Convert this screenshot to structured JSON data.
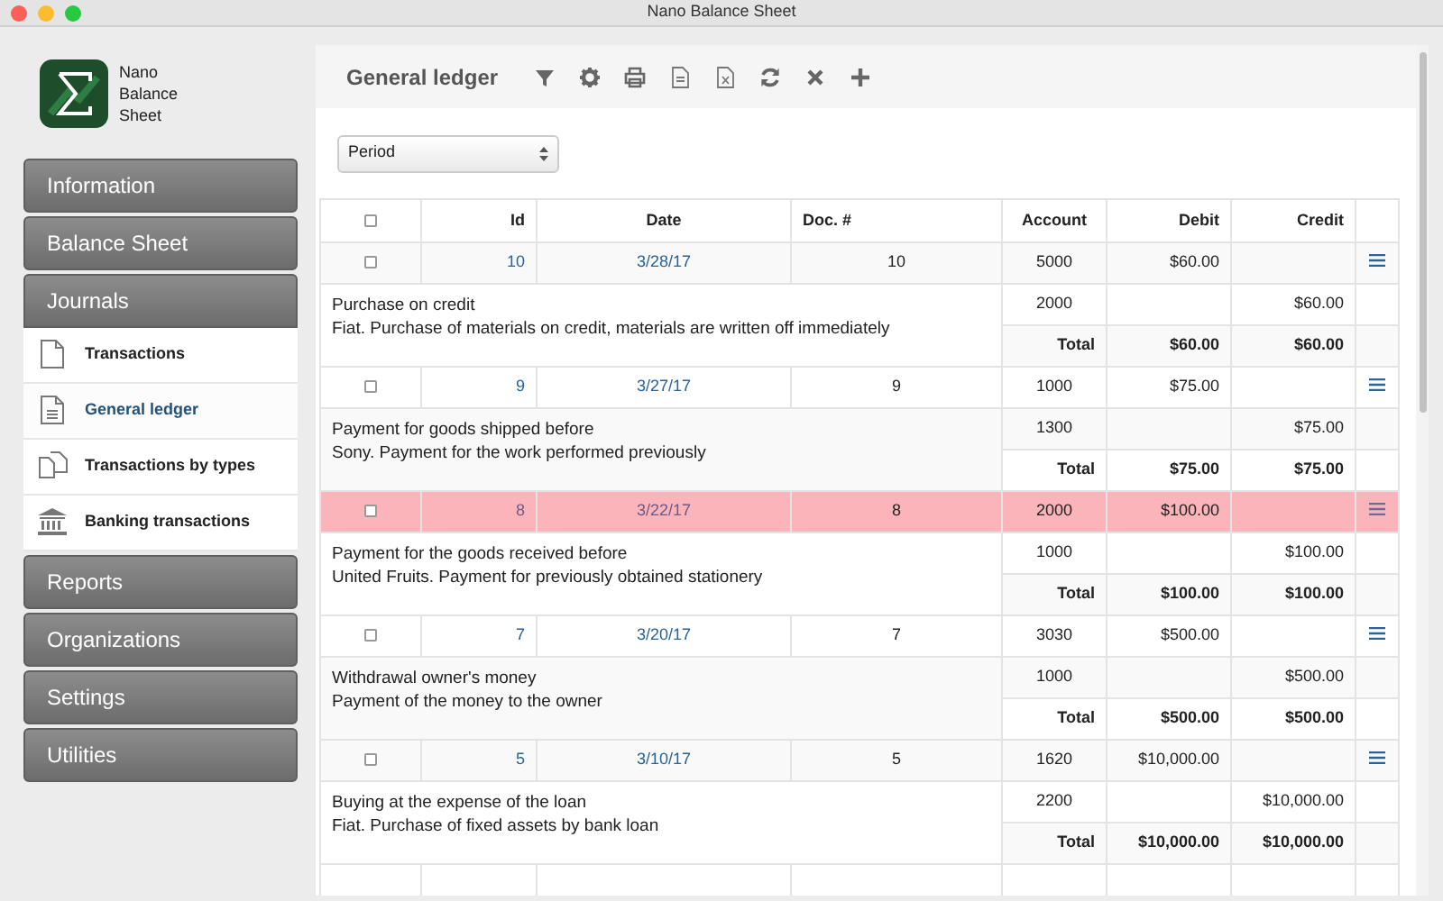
{
  "window": {
    "title": "Nano Balance Sheet"
  },
  "app": {
    "name_lines": [
      "Nano",
      "Balance",
      "Sheet"
    ]
  },
  "sidebar": {
    "items": [
      {
        "label": "Information",
        "expanded": false
      },
      {
        "label": "Balance Sheet",
        "expanded": false
      },
      {
        "label": "Journals",
        "expanded": true,
        "children": [
          {
            "label": "Transactions",
            "selected": false
          },
          {
            "label": "General ledger",
            "selected": true
          },
          {
            "label": "Transactions by types",
            "selected": false
          },
          {
            "label": "Banking transactions",
            "selected": false
          }
        ]
      },
      {
        "label": "Reports",
        "expanded": false
      },
      {
        "label": "Organizations",
        "expanded": false
      },
      {
        "label": "Settings",
        "expanded": false
      },
      {
        "label": "Utilities",
        "expanded": false
      }
    ]
  },
  "toolbar": {
    "title": "General ledger"
  },
  "period_select": {
    "value": "Period"
  },
  "table": {
    "select_all_checked": false,
    "columns": [
      "Id",
      "Date",
      "Doc. #",
      "Account",
      "Debit",
      "Credit"
    ],
    "entries": [
      {
        "checked": false,
        "id": "10",
        "date": "3/28/17",
        "doc": "10",
        "selected": false,
        "description": [
          "Purchase on credit",
          "Fiat. Purchase of materials on credit, materials are written off immediately"
        ],
        "lines": [
          {
            "account": "5000",
            "debit": "$60.00"
          },
          {
            "account": "2000",
            "credit": "$60.00"
          }
        ],
        "total": {
          "label": "Total",
          "debit": "$60.00",
          "credit": "$60.00"
        }
      },
      {
        "checked": false,
        "id": "9",
        "date": "3/27/17",
        "doc": "9",
        "selected": false,
        "description": [
          "Payment for goods shipped before",
          "Sony. Payment for the work performed previously"
        ],
        "lines": [
          {
            "account": "1000",
            "debit": "$75.00"
          },
          {
            "account": "1300",
            "credit": "$75.00"
          }
        ],
        "total": {
          "label": "Total",
          "debit": "$75.00",
          "credit": "$75.00"
        }
      },
      {
        "checked": false,
        "id": "8",
        "date": "3/22/17",
        "doc": "8",
        "selected": true,
        "description": [
          "Payment for the goods received before",
          "United Fruits. Payment for previously obtained stationery"
        ],
        "lines": [
          {
            "account": "2000",
            "debit": "$100.00"
          },
          {
            "account": "1000",
            "credit": "$100.00"
          }
        ],
        "total": {
          "label": "Total",
          "debit": "$100.00",
          "credit": "$100.00"
        }
      },
      {
        "checked": false,
        "id": "7",
        "date": "3/20/17",
        "doc": "7",
        "selected": false,
        "description": [
          "Withdrawal owner's money",
          "Payment of the money to the owner"
        ],
        "lines": [
          {
            "account": "3030",
            "debit": "$500.00"
          },
          {
            "account": "1000",
            "credit": "$500.00"
          }
        ],
        "total": {
          "label": "Total",
          "debit": "$500.00",
          "credit": "$500.00"
        }
      },
      {
        "checked": false,
        "id": "5",
        "date": "3/10/17",
        "doc": "5",
        "selected": false,
        "description": [
          "Buying at the expense of the loan",
          "Fiat. Purchase of fixed assets by bank loan"
        ],
        "lines": [
          {
            "account": "1620",
            "debit": "$10,000.00"
          },
          {
            "account": "2200",
            "credit": "$10,000.00"
          }
        ],
        "total": {
          "label": "Total",
          "debit": "$10,000.00",
          "credit": "$10,000.00"
        }
      }
    ]
  }
}
